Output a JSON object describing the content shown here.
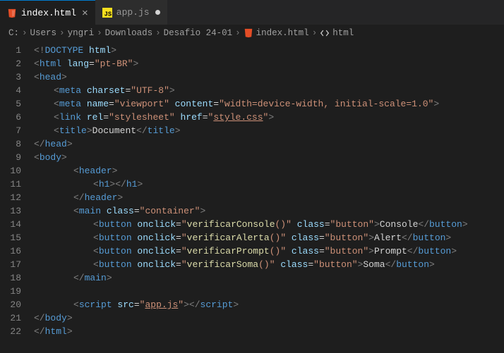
{
  "tabs": [
    {
      "label": "index.html",
      "active": true,
      "modified": false,
      "icon": "html"
    },
    {
      "label": "app.js",
      "active": false,
      "modified": true,
      "icon": "js"
    }
  ],
  "breadcrumb": {
    "parts": [
      "C:",
      "Users",
      "yngri",
      "Downloads",
      "Desafio 24-01"
    ],
    "file": "index.html",
    "symbol": "html"
  },
  "lines": {
    "count": 22,
    "l1": {
      "doctype": "<!",
      "kw": "DOCTYPE",
      "attr": " html",
      "end": ">"
    },
    "l2": {
      "open": "<",
      "tag": "html",
      "attr": " lang",
      "eq": "=",
      "val": "\"pt-BR\"",
      "close": ">"
    },
    "l3": {
      "open": "<",
      "tag": "head",
      "close": ">"
    },
    "l4": {
      "open": "<",
      "tag": "meta",
      "attr": " charset",
      "eq": "=",
      "val": "\"UTF-8\"",
      "close": ">"
    },
    "l5": {
      "open": "<",
      "tag": "meta",
      "attr1": " name",
      "eq": "=",
      "val1": "\"viewport\"",
      "attr2": " content",
      "val2": "\"width=device-width, initial-scale=1.0\"",
      "close": ">"
    },
    "l6": {
      "open": "<",
      "tag": "link",
      "attr1": " rel",
      "eq": "=",
      "val1": "\"stylesheet\"",
      "attr2": " href",
      "val2": "\"",
      "href": "style.css",
      "valend": "\"",
      "close": ">"
    },
    "l7": {
      "open": "<",
      "tag": "title",
      "close": ">",
      "text": "Document",
      "copen": "</",
      "cclose": ">"
    },
    "l8": {
      "open": "</",
      "tag": "head",
      "close": ">"
    },
    "l9": {
      "open": "<",
      "tag": "body",
      "close": ">"
    },
    "l10": {
      "open": "<",
      "tag": "header",
      "close": ">"
    },
    "l11": {
      "open": "<",
      "tag": "h1",
      "close": ">",
      "copen": "</",
      "cclose": ">"
    },
    "l12": {
      "open": "</",
      "tag": "header",
      "close": ">"
    },
    "l13": {
      "open": "<",
      "tag": "main",
      "attr": " class",
      "eq": "=",
      "val": "\"container\"",
      "close": ">"
    },
    "l14": {
      "open": "<",
      "tag": "button",
      "attr1": " onclick",
      "eq": "=",
      "q": "\"",
      "fn": "verificarConsole",
      "paren": "()",
      "attr2": " class",
      "val2": "\"button\"",
      "close": ">",
      "text": "Console",
      "copen": "</",
      "cclose": ">"
    },
    "l15": {
      "open": "<",
      "tag": "button",
      "attr1": " onclick",
      "eq": "=",
      "q": "\"",
      "fn": "verificarAlerta",
      "paren": "()",
      "attr2": " class",
      "val2": "\"button\"",
      "close": ">",
      "text": "Alert",
      "copen": "</",
      "cclose": ">"
    },
    "l16": {
      "open": "<",
      "tag": "button",
      "attr1": " onclick",
      "eq": "=",
      "q": "\"",
      "fn": "verificarPrompt",
      "paren": "()",
      "attr2": " class",
      "val2": "\"button\"",
      "close": ">",
      "text": "Prompt",
      "copen": "</",
      "cclose": ">"
    },
    "l17": {
      "open": "<",
      "tag": "button",
      "attr1": " onclick",
      "eq": "=",
      "q": "\"",
      "fn": "verificarSoma",
      "paren": "()",
      "attr2": " class",
      "val2": "\"button\"",
      "close": ">",
      "text": "Soma",
      "copen": "</",
      "cclose": ">"
    },
    "l18": {
      "open": "</",
      "tag": "main",
      "close": ">"
    },
    "l20": {
      "open": "<",
      "tag": "script",
      "attr": " src",
      "eq": "=",
      "q": "\"",
      "href": "app.js",
      "qend": "\"",
      "close": ">",
      "copen": "</",
      "cclose": ">"
    },
    "l21": {
      "open": "</",
      "tag": "body",
      "close": ">"
    },
    "l22": {
      "open": "</",
      "tag": "html",
      "close": ">"
    }
  }
}
